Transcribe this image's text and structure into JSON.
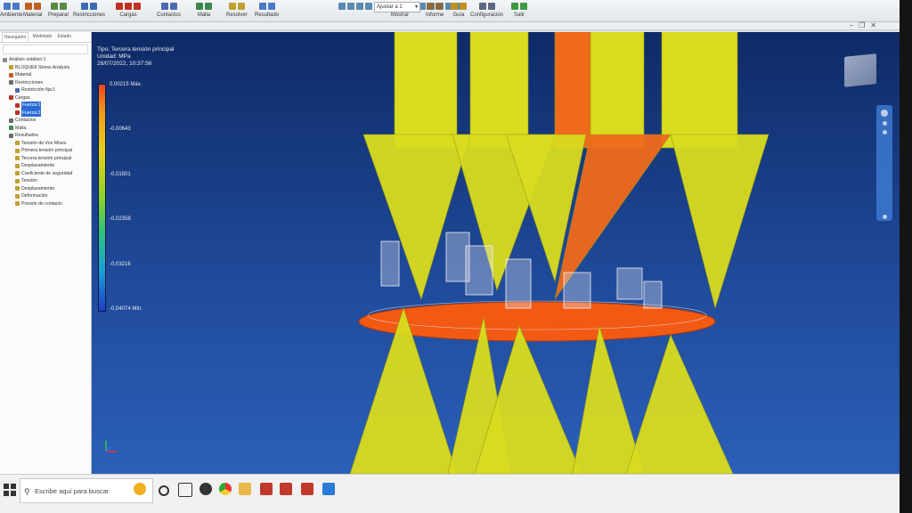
{
  "ribbon": {
    "groups": [
      {
        "label": "Ambiente"
      },
      {
        "label": "Material"
      },
      {
        "label": "Preparar"
      },
      {
        "label": "Restricciones"
      },
      {
        "label": "Cargas"
      },
      {
        "label": "Contactos"
      },
      {
        "label": "Malla"
      },
      {
        "label": "Resolver"
      },
      {
        "label": "Resultado"
      },
      {
        "label": "Mostrar"
      },
      {
        "label": "Informe"
      },
      {
        "label": "Guía"
      },
      {
        "label": "Configuración"
      },
      {
        "label": "Salir"
      }
    ],
    "fit_select": "Ajustar a 1"
  },
  "browser": {
    "tabs": [
      "Navegador",
      "Modelado",
      "Estado"
    ],
    "tree": [
      {
        "label": "Análisis estático:1",
        "indent": 0,
        "icon_color": "#8a8a8a"
      },
      {
        "label": "BLOQUE6 Stress Analysis",
        "indent": 1,
        "icon_color": "#c0a030"
      },
      {
        "label": "Material",
        "indent": 1,
        "icon_color": "#c06020"
      },
      {
        "label": "Restricciones",
        "indent": 1,
        "icon_color": "#6a6a6a"
      },
      {
        "label": "Restricción fija:1",
        "indent": 2,
        "icon_color": "#4a6ab0"
      },
      {
        "label": "Cargas",
        "indent": 1,
        "icon_color": "#c03020"
      },
      {
        "label": "Fuerza:1",
        "indent": 2,
        "icon_color": "#c03020",
        "highlight": true
      },
      {
        "label": "Fuerza:2",
        "indent": 2,
        "icon_color": "#c03020",
        "highlight": true
      },
      {
        "label": "Contactos",
        "indent": 1,
        "icon_color": "#6a6a6a"
      },
      {
        "label": "Malla",
        "indent": 1,
        "icon_color": "#3a8a50"
      },
      {
        "label": "Resultados",
        "indent": 1,
        "icon_color": "#6a6a6a"
      },
      {
        "label": "Tensión de Von Mises",
        "indent": 2,
        "icon_color": "#c0a030"
      },
      {
        "label": "Primera tensión principal",
        "indent": 2,
        "icon_color": "#c0a030"
      },
      {
        "label": "Tercera tensión principal",
        "indent": 2,
        "icon_color": "#c0a030"
      },
      {
        "label": "Desplazamiento",
        "indent": 2,
        "icon_color": "#c0a030"
      },
      {
        "label": "Coeficiente de seguridad",
        "indent": 2,
        "icon_color": "#c0a030"
      },
      {
        "label": "Tensión",
        "indent": 2,
        "icon_color": "#c0a030"
      },
      {
        "label": "Desplazamiento",
        "indent": 2,
        "icon_color": "#c0a030"
      },
      {
        "label": "Deformación",
        "indent": 2,
        "icon_color": "#c0a030"
      },
      {
        "label": "Presión de contacto",
        "indent": 2,
        "icon_color": "#c0a030"
      }
    ]
  },
  "viewport": {
    "type_line": "Tipo: Tercera tensión principal",
    "unit_line": "Unidad: MPa",
    "date_line": "28/07/2022, 10:37:56",
    "legend": [
      {
        "label": "0,00215 Máx.",
        "frac": 0.0
      },
      {
        "label": "-0,00643",
        "frac": 0.2
      },
      {
        "label": "-0,01501",
        "frac": 0.4
      },
      {
        "label": "-0,02358",
        "frac": 0.6
      },
      {
        "label": "-0,03216",
        "frac": 0.8
      },
      {
        "label": "-0,04074 Mín.",
        "frac": 1.0
      }
    ]
  },
  "taskbar": {
    "search_placeholder": "Escribe aquí para buscar"
  },
  "colors": {
    "arrow_yellow": "#d9dc1f",
    "arrow_orange": "#f06a1c",
    "plate_orange": "#f25a14",
    "viewport_top": "#0f2a66",
    "viewport_bottom": "#2b5fb8"
  }
}
